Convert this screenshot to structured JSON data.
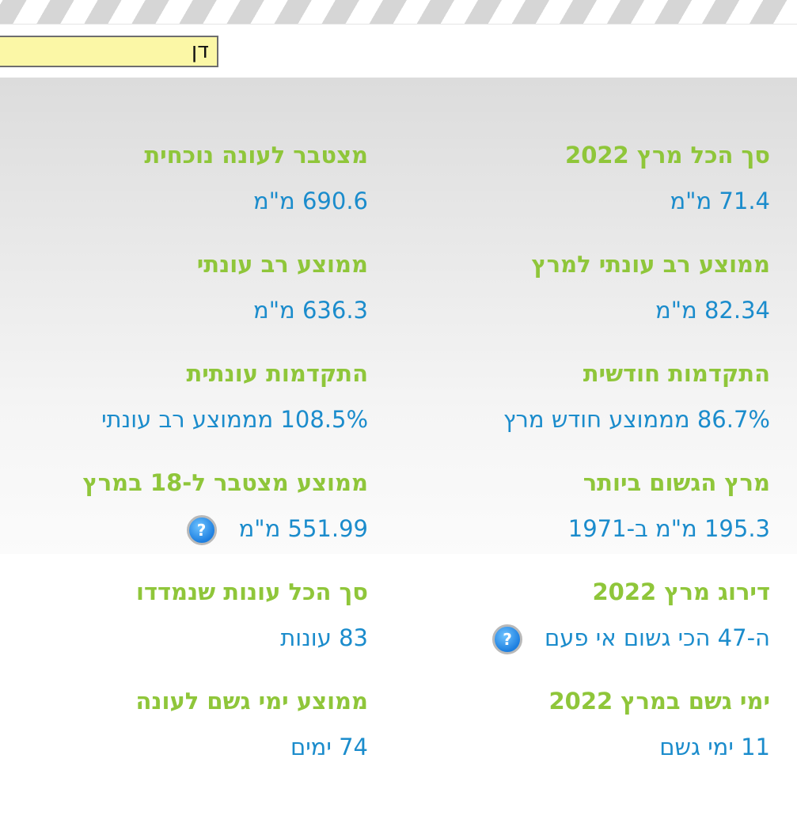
{
  "header": {
    "name_value": "דן"
  },
  "stats": {
    "march_total": {
      "label": "סך הכל מרץ 2022",
      "value": "71.4 מ\"מ"
    },
    "season_cumulative": {
      "label": "מצטבר לעונה נוכחית",
      "value": "690.6 מ\"מ"
    },
    "march_multiyear_avg": {
      "label": "ממוצע רב עונתי למרץ",
      "value": "82.34 מ\"מ"
    },
    "seasonal_multiyear_avg": {
      "label": "ממוצע רב עונתי",
      "value": "636.3 מ\"מ"
    },
    "monthly_progress": {
      "label": "התקדמות חודשית",
      "value": "86.7% מממוצע חודש מרץ"
    },
    "seasonal_progress": {
      "label": "התקדמות עונתית",
      "value": "108.5% מממוצע רב עונתי"
    },
    "rainiest_march": {
      "label": "מרץ הגשום ביותר",
      "value": "195.3 מ\"מ ב-1971"
    },
    "avg_cumulative_18_march": {
      "label": "ממוצע מצטבר ל-18 במרץ",
      "value": "551.99 מ\"מ"
    },
    "march_rank": {
      "label": "דירוג מרץ 2022",
      "value": "ה-47 הכי גשום אי פעם"
    },
    "total_seasons_measured": {
      "label": "סך הכל עונות שנמדדו",
      "value": "83 עונות"
    },
    "rain_days_march": {
      "label": "ימי גשם במרץ 2022",
      "value": "11 ימי גשם"
    },
    "avg_rain_days_season": {
      "label": "ממוצע ימי גשם לעונה",
      "value": "74 ימים"
    }
  },
  "icons": {
    "help": "?"
  },
  "colors": {
    "label": "#8fc63a",
    "value": "#1b8ccc"
  }
}
